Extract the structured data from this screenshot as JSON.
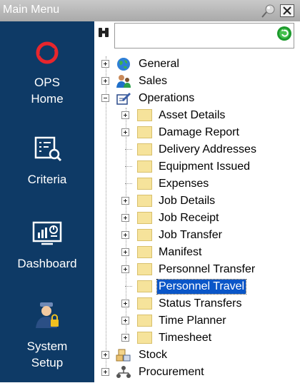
{
  "window": {
    "title": "Main Menu"
  },
  "sidebar": {
    "items": [
      {
        "label": "OPS\nHome",
        "icon": "ops-logo-icon"
      },
      {
        "label": "Criteria",
        "icon": "criteria-search-icon"
      },
      {
        "label": "Dashboard",
        "icon": "dashboard-chart-icon"
      },
      {
        "label": "System\nSetup",
        "icon": "admin-user-icon"
      }
    ]
  },
  "search": {
    "value": "",
    "placeholder": ""
  },
  "tree": {
    "top": [
      {
        "label": "General",
        "icon": "globe-icon"
      },
      {
        "label": "Sales",
        "icon": "user-group-icon"
      },
      {
        "label": "Operations",
        "icon": "edit-icon"
      }
    ],
    "operations_children": [
      {
        "label": "Asset Details",
        "expandable": true
      },
      {
        "label": "Damage Report",
        "expandable": true
      },
      {
        "label": "Delivery Addresses",
        "expandable": false
      },
      {
        "label": "Equipment Issued",
        "expandable": false
      },
      {
        "label": "Expenses",
        "expandable": false
      },
      {
        "label": "Job Details",
        "expandable": true
      },
      {
        "label": "Job Receipt",
        "expandable": true
      },
      {
        "label": "Job Transfer",
        "expandable": true
      },
      {
        "label": "Manifest",
        "expandable": true
      },
      {
        "label": "Personnel Transfer",
        "expandable": true
      },
      {
        "label": "Personnel Travel",
        "expandable": false,
        "selected": true
      },
      {
        "label": "Status Transfers",
        "expandable": true
      },
      {
        "label": "Time Planner",
        "expandable": true
      },
      {
        "label": "Timesheet",
        "expandable": true
      }
    ],
    "bottom": [
      {
        "label": "Stock",
        "icon": "boxes-icon"
      },
      {
        "label": "Procurement",
        "icon": "network-icon"
      }
    ]
  },
  "colors": {
    "sidebar_bg": "#0e3a66",
    "selection": "#0a56c8",
    "folder": "#f6e39b"
  }
}
